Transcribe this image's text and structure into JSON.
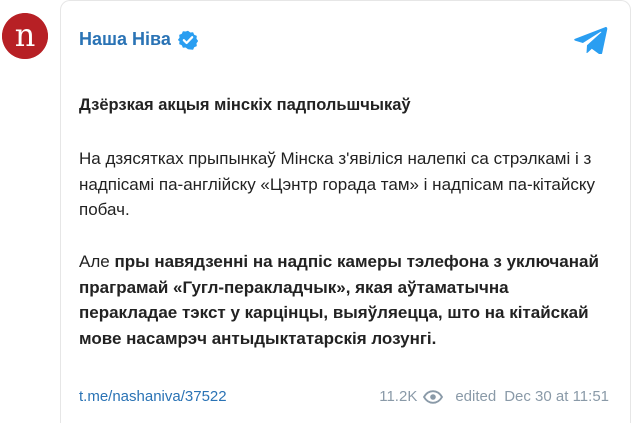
{
  "channel": {
    "name": "Наша Ніва",
    "avatar_letter": "n",
    "brand_color": "#b72025",
    "link_color": "#2a73b5"
  },
  "post": {
    "title": "Дзёрзкая акцыя мінскіх падпольшчыкаў",
    "paragraph1": "На дзясятках прыпынкаў Мінска з'явіліся налепкі са стрэлкамі і з надпісамі па-англійску «Цэнтр горада там» і надпісам па-кітайску побач.",
    "paragraph2_prefix": "Але ",
    "paragraph2_bold": "пры навядзенні на надпіс камеры тэлефона з уключанай праграмай «Гугл-перакладчык», якая аўтаматычна перакладае тэкст у карцінцы, выяўляецца, што на кітайскай мове насамрэч антыдыктатарскія лозунгі."
  },
  "footer": {
    "link": "t.me/nashaniva/37522",
    "views": "11.2K",
    "edited": "edited",
    "date": "Dec 30 at 11:51"
  },
  "icons": {
    "verified": "verified-badge-icon",
    "telegram": "telegram-icon",
    "views": "eye-icon"
  }
}
